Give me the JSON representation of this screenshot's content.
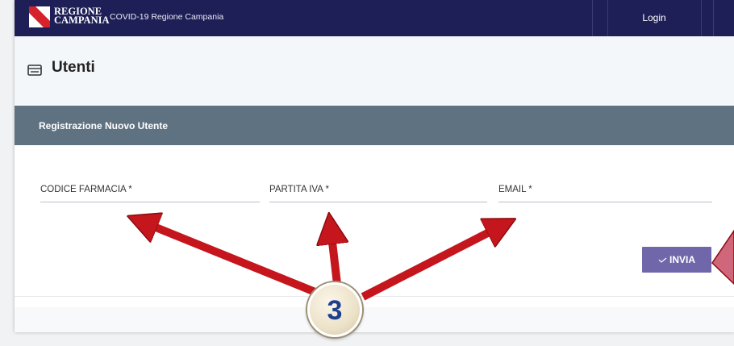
{
  "topbar": {
    "logo_line1": "REGIONE",
    "logo_line2": "CAMPANIA",
    "app_title": "COVID-19 Regione Campania",
    "login_label": "Login"
  },
  "header": {
    "icon": "list-card-icon",
    "title": "Utenti"
  },
  "form": {
    "title": "Registrazione Nuovo Utente",
    "fields": [
      {
        "label": "CODICE FARMACIA *",
        "value": ""
      },
      {
        "label": "PARTITA IVA *",
        "value": ""
      },
      {
        "label": "EMAIL *",
        "value": ""
      }
    ],
    "submit_label": "INVIA",
    "submit_icon": "check-icon"
  },
  "annotation": {
    "step_number": "3",
    "arrow_color": "#c4161c"
  }
}
